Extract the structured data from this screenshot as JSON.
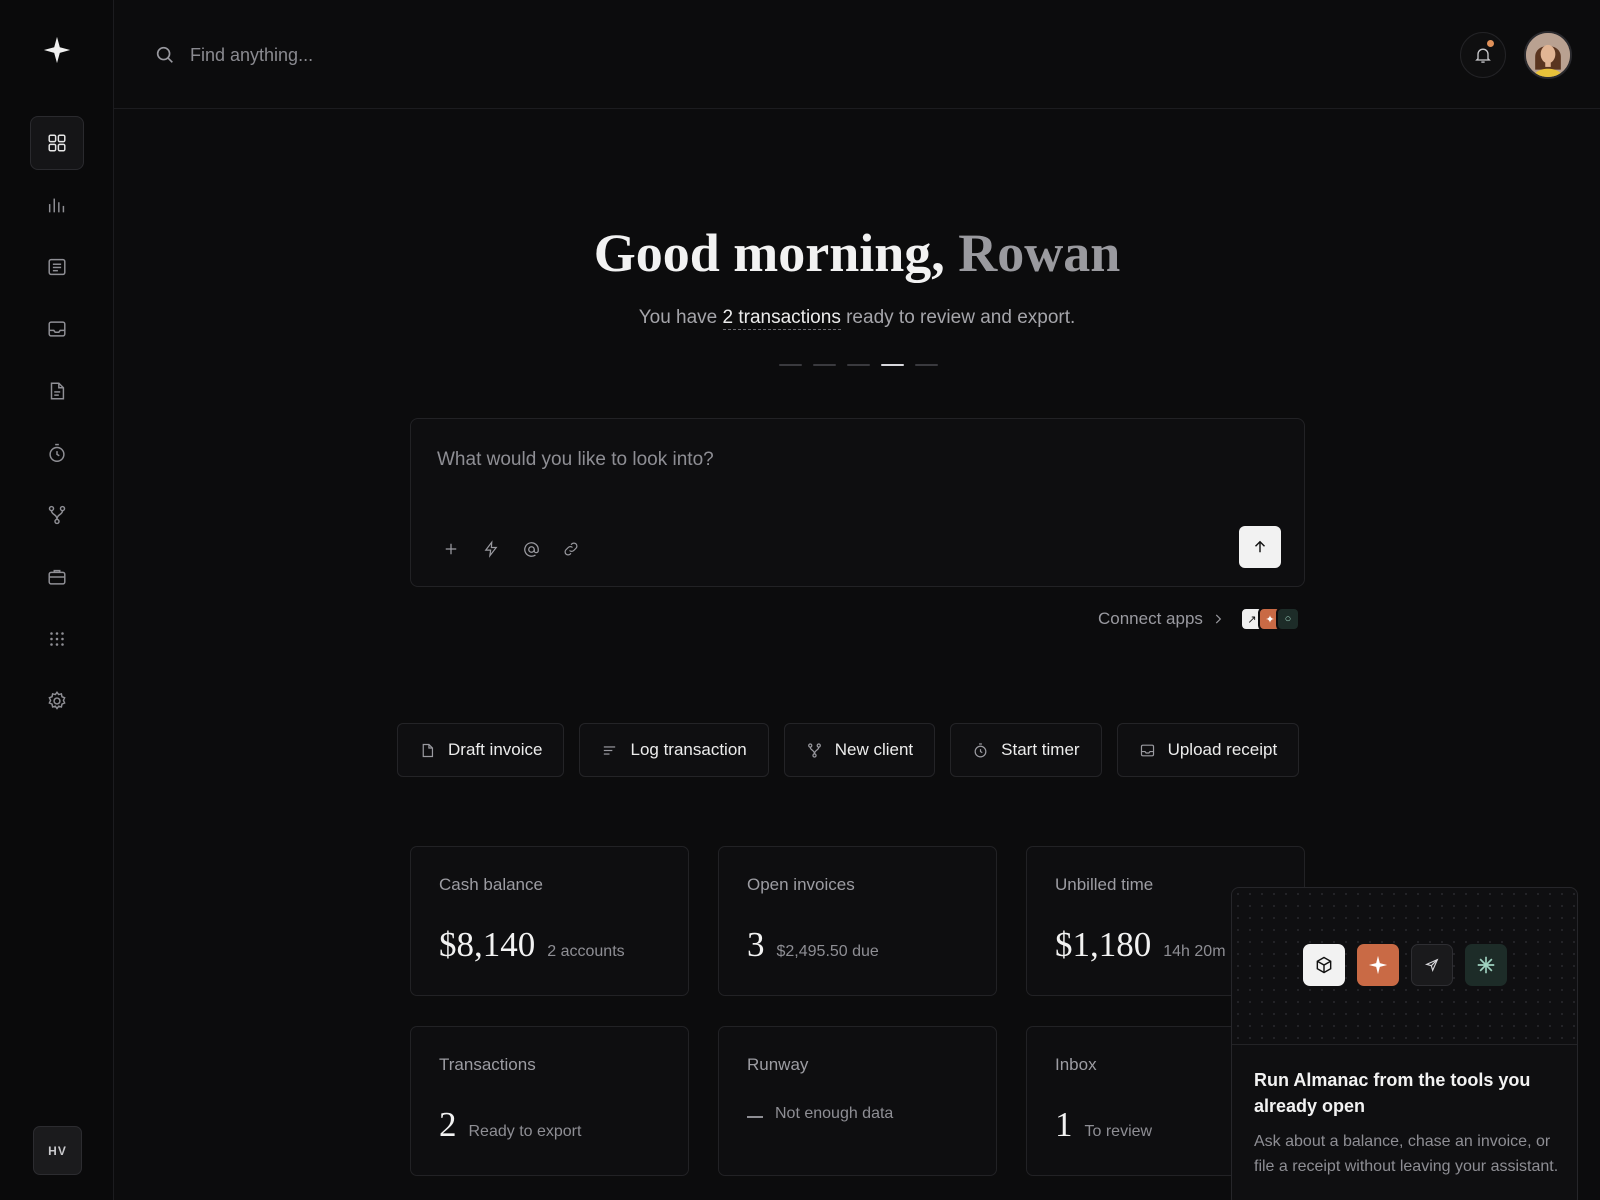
{
  "sidebar": {
    "items": [
      {
        "name": "dashboard",
        "icon": "grid-icon",
        "active": true
      },
      {
        "name": "reports",
        "icon": "bar-chart-icon"
      },
      {
        "name": "documents",
        "icon": "list-icon"
      },
      {
        "name": "inbox",
        "icon": "inbox-icon"
      },
      {
        "name": "invoices",
        "icon": "file-icon"
      },
      {
        "name": "time",
        "icon": "timer-icon"
      },
      {
        "name": "clients",
        "icon": "branch-icon"
      },
      {
        "name": "projects",
        "icon": "briefcase-icon"
      },
      {
        "name": "apps",
        "icon": "dots-grid-icon"
      },
      {
        "name": "settings",
        "icon": "gear-icon"
      }
    ],
    "org_initials": "HV"
  },
  "search": {
    "placeholder": "Find anything..."
  },
  "notifications": {
    "dot_color": "#e0915a"
  },
  "hero": {
    "greeting": "Good morning,",
    "name": "Rowan",
    "sub_before": "You have ",
    "sub_highlight": "2 transactions",
    "sub_after": " ready to review and export.",
    "carousel_index": 3,
    "carousel_count": 5
  },
  "prompt": {
    "placeholder": "What would you like to look into?"
  },
  "connect": {
    "label": "Connect apps"
  },
  "actions": [
    {
      "label": "Draft invoice",
      "icon": "file-icon"
    },
    {
      "label": "Log transaction",
      "icon": "lines-icon"
    },
    {
      "label": "New client",
      "icon": "branch-icon"
    },
    {
      "label": "Start timer",
      "icon": "timer-icon"
    },
    {
      "label": "Upload receipt",
      "icon": "inbox-icon"
    }
  ],
  "cards": [
    {
      "label": "Cash balance",
      "value": "$8,140",
      "sub": "2 accounts"
    },
    {
      "label": "Open invoices",
      "value": "3",
      "sub": "$2,495.50 due"
    },
    {
      "label": "Unbilled time",
      "value": "$1,180",
      "sub": "14h 20m"
    },
    {
      "label": "Transactions",
      "value": "2",
      "sub": "Ready to export"
    },
    {
      "label": "Runway",
      "value": "",
      "sub": "Not enough data"
    },
    {
      "label": "Inbox",
      "value": "1",
      "sub": "To review"
    }
  ],
  "promo": {
    "title": "Run Almanac from the tools you already open",
    "text": "Ask about a balance, chase an invoice, or file a receipt without leaving your assistant."
  },
  "colors": {
    "accent": "#c96a45",
    "teal": "#1d2c28"
  }
}
